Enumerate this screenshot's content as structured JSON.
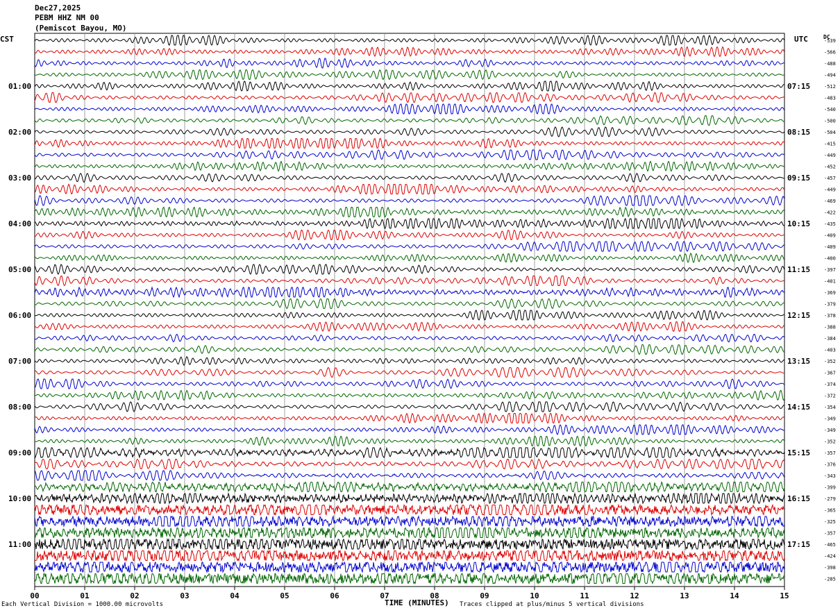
{
  "header": {
    "date": "Dec27,2025",
    "station": "PEBM HHZ NM 00",
    "location": "(Pemiscot Bayou, MO)"
  },
  "left_label": "CST",
  "right_label": "UTC",
  "dc_label": "DC",
  "footer": {
    "scale_note": "Each Vertical Division = 1000.00 microvolts",
    "xlabel": "TIME (MINUTES)",
    "clip_note": "Traces clipped at plus/minus 5 vertical divisions"
  },
  "colors": {
    "trace_cycle": [
      "#000000",
      "#dd0000",
      "#0000cc",
      "#006600"
    ],
    "grid": "#888888",
    "text": "#000000"
  },
  "chart_data": {
    "type": "line",
    "title": "PEBM HHZ NM 00",
    "xlabel": "TIME (MINUTES)",
    "xlim": [
      0,
      15
    ],
    "x_ticks": [
      "00",
      "01",
      "02",
      "03",
      "04",
      "05",
      "06",
      "07",
      "08",
      "09",
      "10",
      "11",
      "12",
      "13",
      "14",
      "15"
    ],
    "rows_per_hour": 4,
    "row_minutes": 15,
    "left_hour_labels": [
      "01:00",
      "02:00",
      "03:00",
      "04:00",
      "05:00",
      "06:00",
      "07:00",
      "08:00",
      "09:00",
      "10:00",
      "11:00"
    ],
    "right_hour_labels": [
      "07:15",
      "08:15",
      "09:15",
      "10:15",
      "11:15",
      "12:15",
      "13:15",
      "14:15",
      "15:15",
      "16:15",
      "17:15"
    ],
    "dc_offsets": [
      539,
      566,
      488,
      494,
      512,
      483,
      540,
      500,
      504,
      415,
      449,
      452,
      457,
      449,
      469,
      422,
      435,
      409,
      409,
      400,
      397,
      401,
      369,
      379,
      378,
      388,
      384,
      403,
      352,
      367,
      374,
      372,
      354,
      349,
      349,
      352,
      357,
      376,
      343,
      399,
      279,
      365,
      325,
      357,
      465,
      424,
      398,
      285
    ],
    "activity": [
      1,
      1,
      1,
      1,
      1,
      1,
      1,
      1,
      1,
      1,
      1,
      1,
      1,
      1,
      1,
      1.2,
      1.2,
      1,
      1,
      1,
      1,
      1,
      1.3,
      1,
      1,
      1,
      1,
      1,
      1,
      1,
      1,
      1,
      1,
      1,
      1,
      1,
      1.5,
      1.2,
      1.2,
      1.6,
      1.8,
      2.2,
      2.2,
      2.2,
      2.4,
      2.4,
      2.4,
      2.4
    ]
  }
}
